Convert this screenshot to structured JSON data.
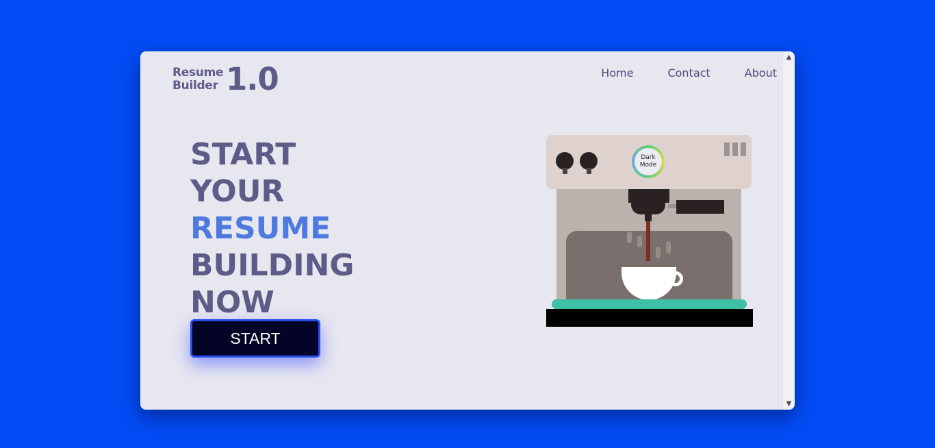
{
  "logo": {
    "line1": "Resume",
    "line2": "Builder",
    "version": "1.0"
  },
  "nav": {
    "items": [
      {
        "label": "Home"
      },
      {
        "label": "Contact"
      },
      {
        "label": "About"
      }
    ]
  },
  "hero": {
    "lines": [
      "START",
      "YOUR",
      "RESUME",
      "BUILDING",
      "NOW"
    ],
    "accent_line": "RESUME"
  },
  "cta": {
    "label": "START"
  },
  "machine": {
    "toggle_label_1": "Dark",
    "toggle_label_2": "Mode"
  },
  "colors": {
    "page_background": "#034cf5",
    "window_background": "#e7e7f0",
    "text_primary": "#5d5b87",
    "accent": "#4e7ae0",
    "button_background": "#040426",
    "tray": "#3ebfa6"
  },
  "scrollbar": {
    "up_icon": "chevron-up-icon",
    "down_icon": "chevron-down-icon"
  }
}
